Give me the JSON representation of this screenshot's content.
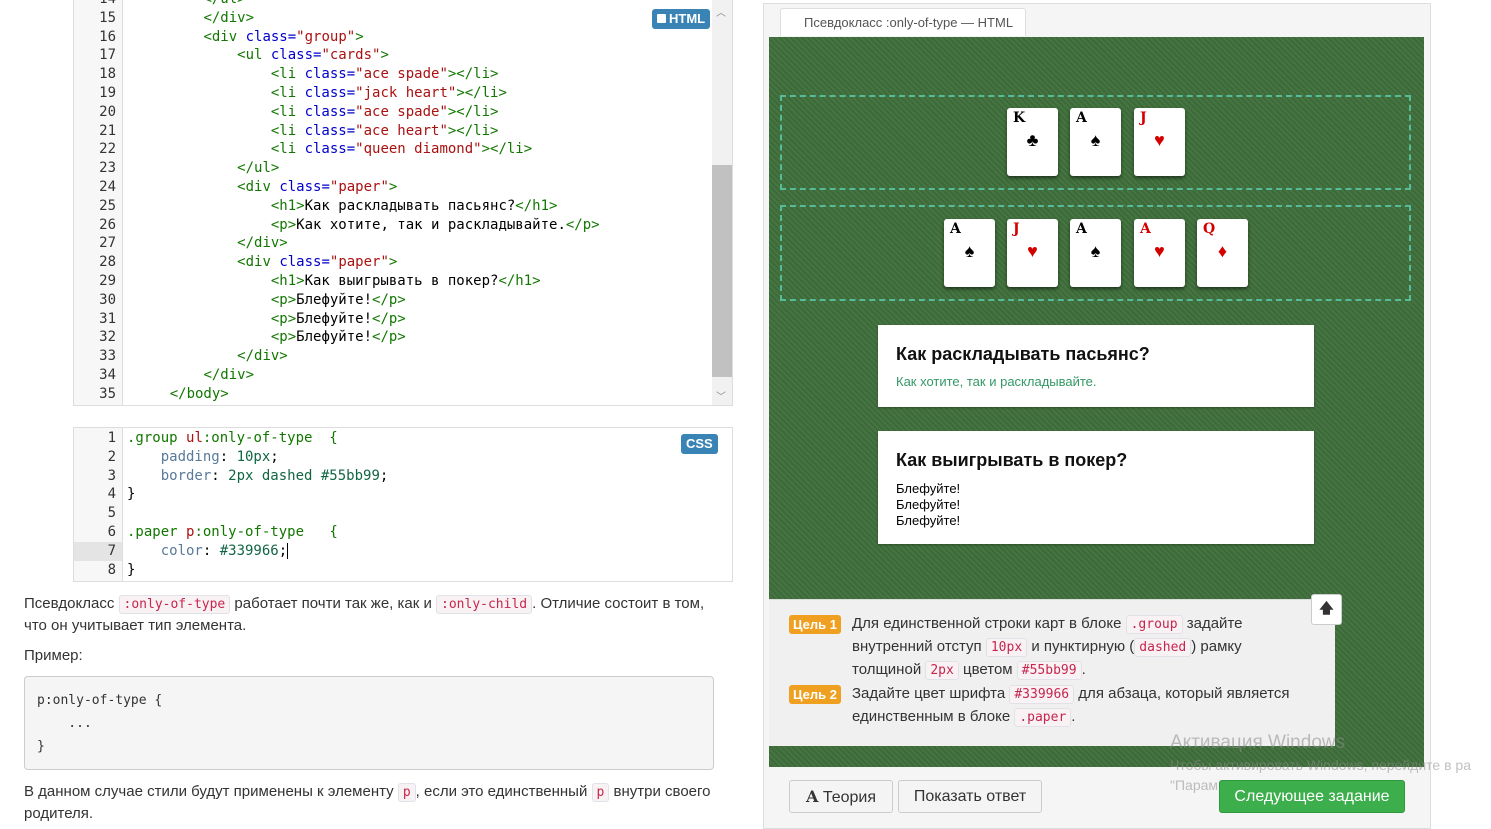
{
  "html_editor": {
    "badge": "HTML",
    "lines": [
      {
        "n": "14",
        "indent": 2,
        "code": [
          {
            "t": "</ul>",
            "c": "tag"
          }
        ]
      },
      {
        "n": "15",
        "indent": 2,
        "code": [
          {
            "t": "</div>",
            "c": "tag"
          }
        ]
      },
      {
        "n": "16",
        "indent": 2,
        "code": [
          {
            "t": "<div ",
            "c": "tag"
          },
          {
            "t": "class=",
            "c": "attr"
          },
          {
            "t": "\"group\"",
            "c": "str"
          },
          {
            "t": ">",
            "c": "tag"
          }
        ]
      },
      {
        "n": "17",
        "indent": 3,
        "code": [
          {
            "t": "<ul ",
            "c": "tag"
          },
          {
            "t": "class=",
            "c": "attr"
          },
          {
            "t": "\"cards\"",
            "c": "str"
          },
          {
            "t": ">",
            "c": "tag"
          }
        ]
      },
      {
        "n": "18",
        "indent": 4,
        "code": [
          {
            "t": "<li ",
            "c": "tag"
          },
          {
            "t": "class=",
            "c": "attr"
          },
          {
            "t": "\"ace spade\"",
            "c": "str"
          },
          {
            "t": "></li>",
            "c": "tag"
          }
        ]
      },
      {
        "n": "19",
        "indent": 4,
        "code": [
          {
            "t": "<li ",
            "c": "tag"
          },
          {
            "t": "class=",
            "c": "attr"
          },
          {
            "t": "\"jack heart\"",
            "c": "str"
          },
          {
            "t": "></li>",
            "c": "tag"
          }
        ]
      },
      {
        "n": "20",
        "indent": 4,
        "code": [
          {
            "t": "<li ",
            "c": "tag"
          },
          {
            "t": "class=",
            "c": "attr"
          },
          {
            "t": "\"ace spade\"",
            "c": "str"
          },
          {
            "t": "></li>",
            "c": "tag"
          }
        ]
      },
      {
        "n": "21",
        "indent": 4,
        "code": [
          {
            "t": "<li ",
            "c": "tag"
          },
          {
            "t": "class=",
            "c": "attr"
          },
          {
            "t": "\"ace heart\"",
            "c": "str"
          },
          {
            "t": "></li>",
            "c": "tag"
          }
        ]
      },
      {
        "n": "22",
        "indent": 4,
        "code": [
          {
            "t": "<li ",
            "c": "tag"
          },
          {
            "t": "class=",
            "c": "attr"
          },
          {
            "t": "\"queen diamond\"",
            "c": "str"
          },
          {
            "t": "></li>",
            "c": "tag"
          }
        ]
      },
      {
        "n": "23",
        "indent": 3,
        "code": [
          {
            "t": "</ul>",
            "c": "tag"
          }
        ]
      },
      {
        "n": "24",
        "indent": 3,
        "code": [
          {
            "t": "<div ",
            "c": "tag"
          },
          {
            "t": "class=",
            "c": "attr"
          },
          {
            "t": "\"paper\"",
            "c": "str"
          },
          {
            "t": ">",
            "c": "tag"
          }
        ]
      },
      {
        "n": "25",
        "indent": 4,
        "code": [
          {
            "t": "<h1>",
            "c": "tag"
          },
          {
            "t": "Как раскладывать пасьянс?",
            "c": "txt"
          },
          {
            "t": "</h1>",
            "c": "tag"
          }
        ]
      },
      {
        "n": "26",
        "indent": 4,
        "code": [
          {
            "t": "<p>",
            "c": "tag"
          },
          {
            "t": "Как хотите, так и раскладывайте.",
            "c": "txt"
          },
          {
            "t": "</p>",
            "c": "tag"
          }
        ]
      },
      {
        "n": "27",
        "indent": 3,
        "code": [
          {
            "t": "</div>",
            "c": "tag"
          }
        ]
      },
      {
        "n": "28",
        "indent": 3,
        "code": [
          {
            "t": "<div ",
            "c": "tag"
          },
          {
            "t": "class=",
            "c": "attr"
          },
          {
            "t": "\"paper\"",
            "c": "str"
          },
          {
            "t": ">",
            "c": "tag"
          }
        ]
      },
      {
        "n": "29",
        "indent": 4,
        "code": [
          {
            "t": "<h1>",
            "c": "tag"
          },
          {
            "t": "Как выигрывать в покер?",
            "c": "txt"
          },
          {
            "t": "</h1>",
            "c": "tag"
          }
        ]
      },
      {
        "n": "30",
        "indent": 4,
        "code": [
          {
            "t": "<p>",
            "c": "tag"
          },
          {
            "t": "Блефуйте!",
            "c": "txt"
          },
          {
            "t": "</p>",
            "c": "tag"
          }
        ]
      },
      {
        "n": "31",
        "indent": 4,
        "code": [
          {
            "t": "<p>",
            "c": "tag"
          },
          {
            "t": "Блефуйте!",
            "c": "txt"
          },
          {
            "t": "</p>",
            "c": "tag"
          }
        ]
      },
      {
        "n": "32",
        "indent": 4,
        "code": [
          {
            "t": "<p>",
            "c": "tag"
          },
          {
            "t": "Блефуйте!",
            "c": "txt"
          },
          {
            "t": "</p>",
            "c": "tag"
          }
        ]
      },
      {
        "n": "33",
        "indent": 3,
        "code": [
          {
            "t": "</div>",
            "c": "tag"
          }
        ]
      },
      {
        "n": "34",
        "indent": 2,
        "code": [
          {
            "t": "</div>",
            "c": "tag"
          }
        ]
      },
      {
        "n": "35",
        "indent": 1,
        "code": [
          {
            "t": "</body>",
            "c": "tag"
          }
        ]
      }
    ]
  },
  "css_editor": {
    "badge": "CSS",
    "lines": [
      {
        "n": "1",
        "code": [
          {
            "t": ".group ",
            "c": "css-sel"
          },
          {
            "t": "ul",
            "c": "str"
          },
          {
            "t": ":only-of-type  {",
            "c": "css-sel"
          }
        ]
      },
      {
        "n": "2",
        "code": [
          {
            "t": "    padding",
            "c": "css-prop"
          },
          {
            "t": ": ",
            "c": "txt"
          },
          {
            "t": "10px",
            "c": "css-val"
          },
          {
            "t": ";",
            "c": "txt"
          }
        ]
      },
      {
        "n": "3",
        "code": [
          {
            "t": "    border",
            "c": "css-prop"
          },
          {
            "t": ": ",
            "c": "txt"
          },
          {
            "t": "2px dashed ",
            "c": "css-val"
          },
          {
            "t": "#55bb99",
            "c": "css-val"
          },
          {
            "t": ";",
            "c": "txt"
          }
        ]
      },
      {
        "n": "4",
        "code": [
          {
            "t": "}",
            "c": "txt"
          }
        ]
      },
      {
        "n": "5",
        "code": []
      },
      {
        "n": "6",
        "code": [
          {
            "t": ".paper ",
            "c": "css-sel"
          },
          {
            "t": "p",
            "c": "str"
          },
          {
            "t": ":only-of-type   {",
            "c": "css-sel"
          }
        ]
      },
      {
        "n": "7",
        "code": [
          {
            "t": "    color",
            "c": "css-prop"
          },
          {
            "t": ": ",
            "c": "txt"
          },
          {
            "t": "#339966",
            "c": "css-val"
          },
          {
            "t": ";",
            "c": "txt"
          }
        ],
        "active": true
      },
      {
        "n": "8",
        "code": [
          {
            "t": "}",
            "c": "txt"
          }
        ]
      }
    ]
  },
  "description": {
    "p1_a": "Псевдокласс ",
    "p1_code1": ":only-of-type",
    "p1_b": " работает почти так же, как и ",
    "p1_code2": ":only-child",
    "p1_c": ". Отличие состоит в том,",
    "p1_d": "что он учитывает тип элемента.",
    "example_label": "Пример:",
    "example_lines": [
      "p:only-of-type {",
      "    ...",
      "}"
    ],
    "p2_a": "В данном случае стили будут применены к элементу ",
    "p2_code1": "p",
    "p2_b": ", если это единственный ",
    "p2_code2": "p",
    "p2_c": " внутри своего",
    "p2_d": "родителя."
  },
  "preview": {
    "tab_title": "Псевдокласс :only-of-type — HTML",
    "group1_cards": [
      {
        "rank": "K",
        "suit": "♣",
        "color": "black"
      },
      {
        "rank": "A",
        "suit": "♠",
        "color": "black"
      },
      {
        "rank": "J",
        "suit": "♥",
        "color": "red"
      }
    ],
    "group2_cards": [
      {
        "rank": "A",
        "suit": "♠",
        "color": "black"
      },
      {
        "rank": "J",
        "suit": "♥",
        "color": "red"
      },
      {
        "rank": "A",
        "suit": "♠",
        "color": "black"
      },
      {
        "rank": "A",
        "suit": "♥",
        "color": "red"
      },
      {
        "rank": "Q",
        "suit": "♦",
        "color": "red"
      }
    ],
    "paper1": {
      "title": "Как раскладывать пасьянс?",
      "text": "Как хотите, так и раскладывайте.",
      "text_color": "#339966"
    },
    "paper2": {
      "title": "Как выигрывать в покер?",
      "lines": [
        "Блефуйте!",
        "Блефуйте!",
        "Блефуйте!"
      ]
    },
    "group_border_color": "#55bb99",
    "table_color": "#3e6e3a"
  },
  "goals": {
    "goal1_badge": "Цель 1",
    "goal1_a": "Для единственной строки карт в блоке ",
    "goal1_code1": ".group",
    "goal1_b": " задайте",
    "goal1_c": "внутренний отступ ",
    "goal1_code2": "10px",
    "goal1_d": " и пунктирную (",
    "goal1_code3": "dashed",
    "goal1_e": ") рамку",
    "goal1_f": "толщиной ",
    "goal1_code4": "2px",
    "goal1_g": " цветом ",
    "goal1_code5": "#55bb99",
    "goal1_h": ".",
    "goal2_badge": "Цель 2",
    "goal2_a": "Задайте цвет шрифта ",
    "goal2_code1": "#339966",
    "goal2_b": " для абзаца, который является",
    "goal2_c": "единственным в блоке ",
    "goal2_code2": ".paper",
    "goal2_d": ".",
    "up_icon": "arrow-up-icon",
    "badge_color": "#f0a020"
  },
  "buttons": {
    "theory_icon": "A",
    "theory": "Теория",
    "show_answer": "Показать ответ",
    "next": "Следующее задание"
  },
  "watermark": {
    "line1": "Активация Windows",
    "line2": "Чтобы активировать Windows, перейдите в ра",
    "line3": "\"Парам"
  }
}
